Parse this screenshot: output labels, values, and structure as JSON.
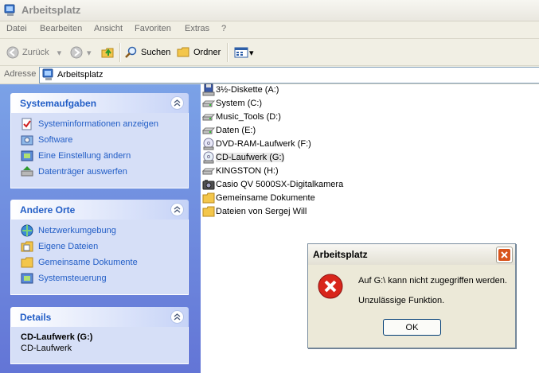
{
  "window": {
    "title": "Arbeitsplatz"
  },
  "menu": [
    "Datei",
    "Bearbeiten",
    "Ansicht",
    "Favoriten",
    "Extras",
    "?"
  ],
  "toolbar": {
    "back": "Zurück",
    "search": "Suchen",
    "folders": "Ordner"
  },
  "address": {
    "label": "Adresse",
    "value": "Arbeitsplatz"
  },
  "panels": {
    "system": {
      "title": "Systemaufgaben",
      "items": [
        "Systeminformationen anzeigen",
        "Software",
        "Eine Einstellung ändern",
        "Datenträger auswerfen"
      ]
    },
    "other": {
      "title": "Andere Orte",
      "items": [
        "Netzwerkumgebung",
        "Eigene Dateien",
        "Gemeinsame Dokumente",
        "Systemsteuerung"
      ]
    },
    "details": {
      "title": "Details",
      "name": "CD-Laufwerk (G:)",
      "type": "CD-Laufwerk"
    }
  },
  "files": [
    "3½-Diskette (A:)",
    "System (C:)",
    "Music_Tools (D:)",
    "Daten (E:)",
    "DVD-RAM-Laufwerk (F:)",
    "CD-Laufwerk (G:)",
    "KINGSTON (H:)",
    "Casio QV 5000SX-Digitalkamera",
    "Gemeinsame Dokumente",
    "Dateien von Sergej Will"
  ],
  "dialog": {
    "title": "Arbeitsplatz",
    "message": "Auf G:\\ kann nicht zugegriffen werden.",
    "detail": "Unzulässige Funktion.",
    "ok": "OK"
  },
  "colors": {
    "link_blue": "#215dc6",
    "pane_blue": "#7ba2e7",
    "error_red": "#d8261c"
  }
}
